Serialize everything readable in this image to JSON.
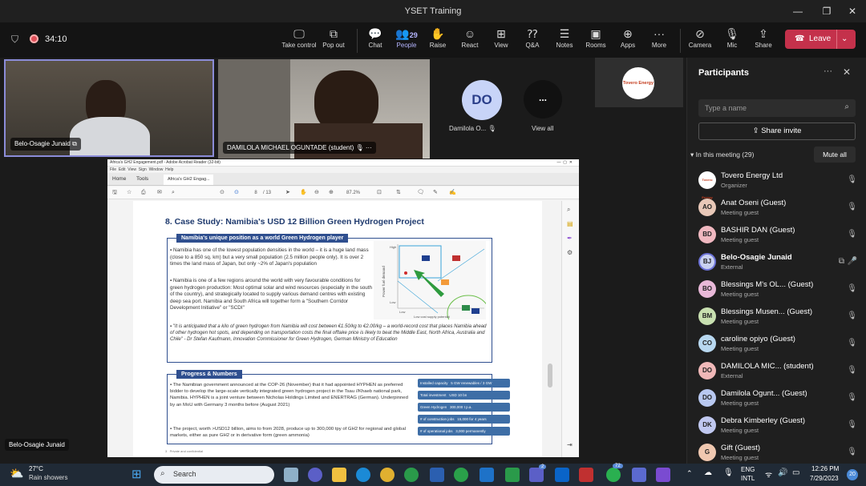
{
  "window": {
    "title": "YSET Training"
  },
  "call": {
    "timer": "34:10"
  },
  "toolbar": {
    "take_control": "Take control",
    "pop_out": "Pop out",
    "chat": "Chat",
    "people": "People",
    "people_count": "29",
    "raise": "Raise",
    "react": "React",
    "view": "View",
    "qa": "Q&A",
    "notes": "Notes",
    "rooms": "Rooms",
    "apps": "Apps",
    "more": "More",
    "camera": "Camera",
    "mic": "Mic",
    "share": "Share",
    "leave": "Leave"
  },
  "stage": {
    "tile1_name": "Belo-Osagie Junaid",
    "tile2_name": "DAMILOLA MICHAEL OGUNTADE (student)",
    "tile3_initials": "DO",
    "tile3_name": "Damilola O...",
    "view_all_icon": "...",
    "view_all": "View all",
    "org_logo_text": "Tovero Energy",
    "presenter_name": "Belo-Osagie Junaid"
  },
  "pdf": {
    "window_title": "Africa's GH2 Engagement.pdf - Adobe Acrobat Reader (32-bit)",
    "menu": [
      "File",
      "Edit",
      "View",
      "Sign",
      "Window",
      "Help"
    ],
    "tabs": [
      "Home",
      "Tools",
      "Africa's GH2 Engag..."
    ],
    "page_num": "8",
    "page_total": "/ 13",
    "zoom": "87.2%",
    "slide_title": "8. Case Study: Namibia's USD 12 Billion Green Hydrogen Project",
    "box1_header": "Namibia's unique position as a world Green Hydrogen player",
    "bullet1": "Namibia has one of the lowest population densities in the world – it is a huge land mass (close to a 850 sq. km) but a very small population (2.5 million people only). It is over 2 times the land mass of Japan, but only ~2% of Japan's population",
    "bullet2": "Namibia is one of a few regions around the world with very favourable conditions for green hydrogen production: Most optimal solar and wind resources (especially in the south of the country), and strategically located to supply various demand centres with existing deep sea port. Namibia and South Africa will together form a \"Southern Corridor Development Initiative\" or \"SCDI\"",
    "bullet3": "\"It is anticipated that a kilo of green hydrogen from Namibia will cost between €1.50/kg to €2.00/kg – a world-record cost that places Namibia ahead of other hydrogen hot spots, and depending on transportation costs the final offtake price is likely to beat the Middle East, North Africa, Australia and Chile\" - Dr Stefan Kaufmann, Innovation Commissioner for Green Hydrogen, German Ministry of Education",
    "chart_y_label": "Power fuel demand",
    "chart_x_label": "Low cost supply potential",
    "chart_high": "High",
    "chart_low": "Low",
    "box2_header": "Progress & Numbers",
    "bullet4": "The Namibian government announced at the COP-26 (November) that it had appointed HYPHEN as preferred bidder to develop the large-scale vertically integrated green hydrogen project in the Tsau //Khaeb national park, Namibia. HYPHEN is a joint venture between Nicholas Holdings Limited and ENERTRAG (German). Underpinned by an MoU with Germany 3 months before (August 2021)",
    "bullet5": "The project, worth >USD12 billion, aims to from 2028, produce up to 300,000 tpy of GH2 for regional and global markets, either as pure GH2 or in derivative form (green ammonia)",
    "stats": [
      {
        "label": "Installed capacity",
        "value": "5 GW renewables / 3 GW electrolysis"
      },
      {
        "label": "Total investment",
        "value": "USD 10 bn"
      },
      {
        "label": "Green Hydrogen",
        "value": "300,000 t p.a."
      },
      {
        "label": "# of construction jobs",
        "value": "15,000 for 4 years"
      },
      {
        "label": "# of operational jobs",
        "value": "3,000 permanently"
      }
    ],
    "footer": "Private and confidential",
    "page_footer_num": "3"
  },
  "panel": {
    "title": "Participants",
    "search_placeholder": "Type a name",
    "share_invite": "Share invite",
    "in_meeting": "In this meeting (29)",
    "mute_all": "Mute all",
    "people": [
      {
        "initials": "",
        "name": "Tovero Energy Ltd",
        "role": "Organizer",
        "color": "#ffffff"
      },
      {
        "initials": "AO",
        "name": "Anat Oseni (Guest)",
        "role": "Meeting guest",
        "color": "#e8c8b8"
      },
      {
        "initials": "BD",
        "name": "BASHIR DAN (Guest)",
        "role": "Meeting guest",
        "color": "#f0b8c0"
      },
      {
        "initials": "BJ",
        "name": "Belo-Osagie Junaid",
        "role": "External",
        "color": "#c8d0f0"
      },
      {
        "initials": "BO",
        "name": "Blessings M's OL... (Guest)",
        "role": "Meeting guest",
        "color": "#e8b8d8"
      },
      {
        "initials": "BM",
        "name": "Blessings Musen... (Guest)",
        "role": "Meeting guest",
        "color": "#c8e0b0"
      },
      {
        "initials": "CO",
        "name": "caroline opiyo (Guest)",
        "role": "Meeting guest",
        "color": "#b8d8f0"
      },
      {
        "initials": "DO",
        "name": "DAMILOLA MIC... (student)",
        "role": "External",
        "color": "#f0b8b8"
      },
      {
        "initials": "DO",
        "name": "Damilola Ogunt... (Guest)",
        "role": "Meeting guest",
        "color": "#b8c8f0"
      },
      {
        "initials": "DK",
        "name": "Debra Kimberley (Guest)",
        "role": "Meeting guest",
        "color": "#c0c8f0"
      },
      {
        "initials": "G",
        "name": "Gift (Guest)",
        "role": "Meeting guest",
        "color": "#f0c8b0"
      }
    ]
  },
  "taskbar": {
    "weather_temp": "27°C",
    "weather_text": "Rain showers",
    "search": "Search",
    "lang1": "ENG",
    "lang2": "INTL",
    "time": "12:26 PM",
    "date": "7/29/2023",
    "badge_teams": "2",
    "badge_whatsapp": "72",
    "notif": "20"
  }
}
